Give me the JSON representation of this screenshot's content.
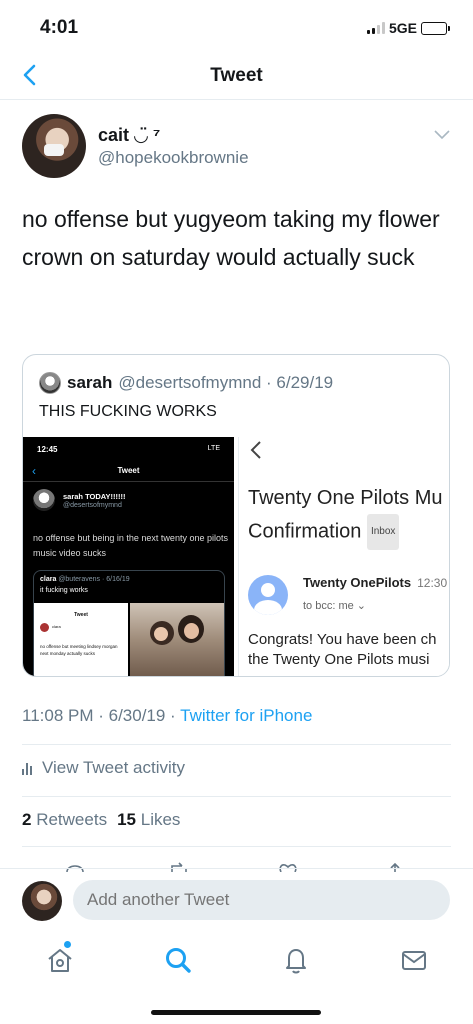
{
  "status_bar": {
    "time": "4:01",
    "network": "5GE"
  },
  "nav": {
    "title": "Tweet"
  },
  "tweet": {
    "author_name": "cait ◡̈ ⁷",
    "author_handle": "@hopekookbrownie",
    "text": "no offense but yugyeom taking my flower crown on saturday would actually suck",
    "timestamp": "11:08 PM · 6/30/19 · ",
    "source": "Twitter for iPhone"
  },
  "quoted_tweet": {
    "author_name": "sarah",
    "meta": "@desertsofmymnd · 6/29/19",
    "text": "THIS FUCKING WORKS",
    "media_left": {
      "time": "12:45",
      "status": "LTE",
      "back_icon": "‹",
      "title": "Tweet",
      "name": "sarah TODAY!!!!!!",
      "handle": "@desertsofmymnd",
      "text": "no offense but being in the next twenty one pilots music video sucks",
      "nested_author": "clara",
      "nested_meta": "@buteravens · 6/16/19",
      "nested_text": "it fucking works",
      "nested_shot_title": "Tweet",
      "nested_shot_name": "clara",
      "nested_shot_text": "no offense but meeting lindsey morgan next monday actually sucks"
    },
    "media_right": {
      "subject": "Twenty One Pilots Mu",
      "subject_line2": "Confirmation",
      "inbox_label": "Inbox",
      "sender": "Twenty OnePilots",
      "sent_time": "12:30",
      "to": "to bcc: me ⌄",
      "body_line1": "Congrats! You have been ch",
      "body_line2": "the Twenty One Pilots musi"
    }
  },
  "activity": {
    "label": "View Tweet activity"
  },
  "stats": {
    "retweets_count": "2",
    "retweets_label": "Retweets",
    "likes_count": "15",
    "likes_label": "Likes"
  },
  "reply_bar": {
    "placeholder": "Add another Tweet"
  },
  "tabs": [
    "home-icon",
    "search-icon",
    "notifications-icon",
    "messages-icon"
  ],
  "colors": {
    "accent": "#1da1f2",
    "secondary_text": "#657786",
    "divider": "#e6ecf0"
  }
}
